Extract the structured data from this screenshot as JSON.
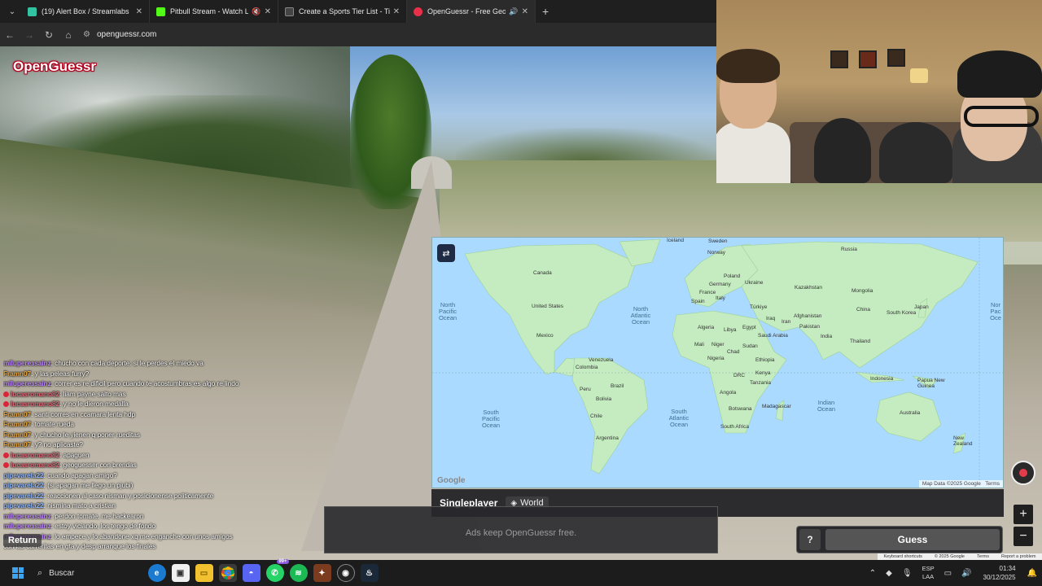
{
  "tabs": [
    {
      "title": "(19) Alert Box / Streamlabs",
      "icon": "streamlabs-icon",
      "color": "#31c3a2",
      "active": false
    },
    {
      "title": "Pitbull Stream - Watch Live",
      "icon": "kick-icon",
      "color": "#53fc18",
      "active": false
    },
    {
      "title": "Create a Sports Tier List - TierM",
      "icon": "tiermaker-icon",
      "color": "#444444",
      "active": false
    },
    {
      "title": "OpenGuessr - Free GeoGue",
      "icon": "openguessr-icon",
      "color": "#e8304a",
      "active": true
    }
  ],
  "address": {
    "url": "openguessr.com"
  },
  "logo": "OpenGuessr",
  "chat": [
    {
      "user": "milupereзsainz",
      "color": "#c28bff",
      "badge": false,
      "msg": "chucho con cada deporte: si le perdes el miedo va"
    },
    {
      "user": "Framn07",
      "color": "#e7a43a",
      "badge": false,
      "msg": "y las peleas furry?"
    },
    {
      "user": "milupereзsainz",
      "color": "#c28bff",
      "badge": false,
      "msg": "correr es re dificil pero cuando te acostumbras es algo re lindo"
    },
    {
      "user": "lucasromano82",
      "color": "#e06b7a",
      "badge": true,
      "msg": "liam payne salto mas"
    },
    {
      "user": "lucasromano82",
      "color": "#e06b7a",
      "badge": true,
      "msg": "y no le dieron medalla"
    },
    {
      "user": "Framn07",
      "color": "#e7a43a",
      "badge": false,
      "msg": "santi corres en ccamara lenta hdp"
    },
    {
      "user": "Framn07",
      "color": "#e7a43a",
      "badge": false,
      "msg": "tomate rueda"
    },
    {
      "user": "Framn07",
      "color": "#e7a43a",
      "badge": false,
      "msg": "y chucho le yienen q poner rueditas"
    },
    {
      "user": "Framn07",
      "color": "#e7a43a",
      "badge": false,
      "msg": "y? no aplicaste?"
    },
    {
      "user": "lucasromano82",
      "color": "#e06b7a",
      "badge": true,
      "msg": "apaguen"
    },
    {
      "user": "lucasromano82",
      "color": "#e06b7a",
      "badge": true,
      "msg": "geoguesser con brendas"
    },
    {
      "user": "pipevarela22",
      "color": "#8fb8ff",
      "badge": false,
      "msg": "cuando apagan amigo?"
    },
    {
      "user": "pipevarela22",
      "color": "#8fb8ff",
      "badge": false,
      "msg": "(si apagan me llego un pjubi)"
    },
    {
      "user": "pipevarela22",
      "color": "#8fb8ff",
      "badge": false,
      "msg": "reaccionen al caso nisman y posicionense politicamente"
    },
    {
      "user": "pipevarela22",
      "color": "#8fb8ff",
      "badge": false,
      "msg": "nismina mato a cristian"
    },
    {
      "user": "milupereзsainz",
      "color": "#c28bff",
      "badge": false,
      "msg": "perdon tomate, me hackearon"
    },
    {
      "user": "milupereзsainz",
      "color": "#c28bff",
      "badge": false,
      "msg": "estoy viciando, los tengo de fondo"
    },
    {
      "user": "milupereзsainz",
      "color": "#c28bff",
      "badge": false,
      "msg": "lo empece y lo abandone xq me enganche con unos amigos"
    },
    {
      "user": "",
      "color": "#ffffff",
      "badge": false,
      "msg": "con las carreritas en gta y desp arranque los finales"
    }
  ],
  "map": {
    "labels": {
      "canada": "Canada",
      "united_states": "United States",
      "mexico": "Mexico",
      "venezuela": "Venezuela",
      "colombia": "Colombia",
      "peru": "Peru",
      "brazil": "Brazil",
      "bolivia": "Bolivia",
      "chile": "Chile",
      "argentina": "Argentina",
      "iceland": "Iceland",
      "sweden": "Sweden",
      "norway": "Norway",
      "poland": "Poland",
      "germany": "Germany",
      "ukraine": "Ukraine",
      "france": "France",
      "spain": "Spain",
      "italy": "Italy",
      "turkiye": "Türkiye",
      "algeria": "Algeria",
      "libya": "Libya",
      "egypt": "Egypt",
      "mali": "Mali",
      "niger": "Niger",
      "nigeria": "Nigeria",
      "chad": "Chad",
      "sudan": "Sudan",
      "ethiopia": "Ethiopia",
      "kenya": "Kenya",
      "tanzania": "Tanzania",
      "drc": "DRC",
      "angola": "Angola",
      "botswana": "Botswana",
      "south_africa": "South Africa",
      "madagascar": "Madagascar",
      "saudi_arabia": "Saudi Arabia",
      "iraq": "Iraq",
      "iran": "Iran",
      "afghanistan": "Afghanistan",
      "pakistan": "Pakistan",
      "india": "India",
      "russia": "Russia",
      "kazakhstan": "Kazakhstan",
      "mongolia": "Mongolia",
      "china": "China",
      "south_korea": "South Korea",
      "japan": "Japan",
      "thailand": "Thailand",
      "indonesia": "Indonesia",
      "papua_new_guinea": "Papua New Guinea",
      "australia": "Australia",
      "new_zealand": "New Zealand"
    },
    "oceans": {
      "north_pacific": "North Pacific Ocean",
      "north_atlantic": "North Atlantic Ocean",
      "south_pacific": "South Pacific Ocean",
      "south_atlantic": "South Atlantic Ocean",
      "indian": "Indian Ocean",
      "north_pacific_right": "Nor Pac Oce"
    },
    "attribution": "Map Data ©2025 Google",
    "terms": "Terms",
    "google_logo": "Google"
  },
  "game": {
    "mode": "Singleplayer",
    "region": "World",
    "guess": "Guess",
    "help": "?",
    "ads": "Ads keep OpenGuessr free.",
    "return": "Return"
  },
  "footer": {
    "shortcuts": "Keyboard shortcuts",
    "mapdata": "© 2025 Google",
    "terms": "Terms",
    "report": "Report a problem"
  },
  "taskbar": {
    "search": "Buscar",
    "lang1": "ESP",
    "lang2": "LAA",
    "time": "01:34",
    "date": "30/12/2025",
    "whatsapp_badge": "99+"
  }
}
